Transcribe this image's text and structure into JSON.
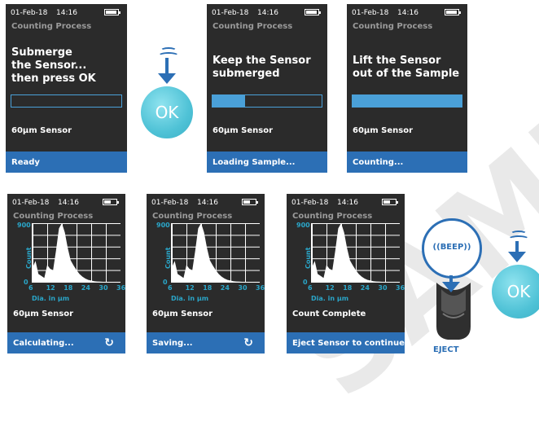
{
  "watermark": "SAMPLE",
  "colors": {
    "screen_bg": "#2b2b2b",
    "accent": "#2c6fb5",
    "bar": "#4aa0d8",
    "chart_text": "#2aa6c9",
    "ok": "#4fc2d6"
  },
  "screens": [
    {
      "date": "01-Feb-18",
      "time": "14:16",
      "battery_level": 0.85,
      "title": "Counting Process",
      "line1": "Submerge",
      "line2": "the Sensor...",
      "line3": "then press OK",
      "progress": 0.0,
      "sensor": "60μm Sensor",
      "footer": "Ready"
    },
    {
      "date": "01-Feb-18",
      "time": "14:16",
      "battery_level": 0.85,
      "title": "Counting Process",
      "line1": "Keep the Sensor",
      "line2": "submerged",
      "progress": 0.3,
      "sensor": "60μm Sensor",
      "footer": "Loading Sample..."
    },
    {
      "date": "01-Feb-18",
      "time": "14:16",
      "battery_level": 0.85,
      "title": "Counting Process",
      "line1": "Lift the Sensor",
      "line2": "out of the Sample",
      "progress": 1.0,
      "sensor": "60μm Sensor",
      "footer": "Counting..."
    },
    {
      "date": "01-Feb-18",
      "time": "14:16",
      "battery_level": 0.6,
      "title": "Counting Process",
      "sensor": "60μm Sensor",
      "footer": "Calculating...",
      "footer_icon": "refresh-icon"
    },
    {
      "date": "01-Feb-18",
      "time": "14:16",
      "battery_level": 0.6,
      "title": "Counting Process",
      "sensor": "60μm Sensor",
      "footer": "Saving...",
      "footer_icon": "refresh-icon"
    },
    {
      "date": "01-Feb-18",
      "time": "14:16",
      "battery_level": 0.6,
      "title": "Counting Process",
      "sensor": "Count Complete",
      "footer": "Eject Sensor to continue"
    }
  ],
  "chart_data": {
    "type": "area",
    "ylabel": "Count",
    "xlabel": "Dia. in μm",
    "y_ticks": [
      "900",
      "0"
    ],
    "x_ticks": [
      "6",
      "12",
      "18",
      "24",
      "30",
      "36"
    ],
    "ylim": [
      0,
      900
    ],
    "xlim": [
      6,
      36
    ],
    "x": [
      6,
      7,
      8,
      9,
      10,
      11,
      12,
      13,
      14,
      15,
      16,
      17,
      18,
      19,
      20,
      21,
      22,
      23,
      24,
      25,
      26,
      27,
      28,
      29,
      30
    ],
    "values": [
      220,
      320,
      120,
      90,
      60,
      260,
      200,
      180,
      480,
      820,
      900,
      760,
      520,
      330,
      250,
      180,
      120,
      80,
      50,
      30,
      20,
      10,
      5,
      3,
      0
    ]
  },
  "ok_button": {
    "label": "OK"
  },
  "beep": {
    "label": "((BEEP))"
  },
  "eject": {
    "label": "EJECT"
  }
}
